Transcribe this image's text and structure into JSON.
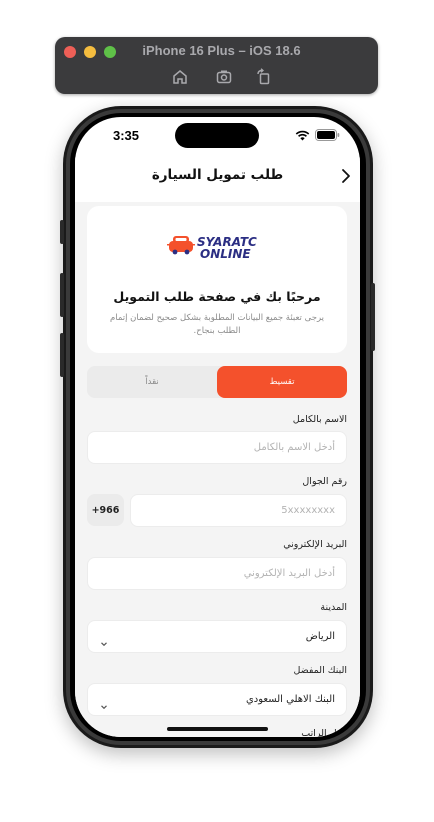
{
  "simulator": {
    "title": "iPhone 16 Plus – iOS 18.6",
    "tools": [
      "home-icon",
      "screenshot-icon",
      "rotate-icon"
    ]
  },
  "status_bar": {
    "time": "3:35"
  },
  "nav": {
    "title": "طلب تمويل السيارة",
    "back_icon": "chevron-right-icon"
  },
  "welcome": {
    "logo_text_1": "SYARATC",
    "logo_text_2": "ONLINE",
    "title": "مرحبًا بك في صفحة طلب التمويل",
    "subtitle": "يرجى تعبئة جميع البيانات المطلوبة بشكل صحيح لضمان إتمام الطلب بنجاح."
  },
  "payment_toggle": {
    "active": "تقسيط",
    "inactive": "نقداً"
  },
  "form": {
    "full_name": {
      "label": "الاسم بالكامل",
      "placeholder": "أدخل الاسم بالكامل"
    },
    "phone": {
      "label": "رقم الجوال",
      "prefix": "+966",
      "placeholder": "5xxxxxxxx"
    },
    "email": {
      "label": "البريد الإلكتروني",
      "placeholder": "أدخل البريد الإلكتروني"
    },
    "city": {
      "label": "المدينة",
      "value": "الرياض"
    },
    "bank": {
      "label": "البنك المفضل",
      "value": "البنك الاهلي السعودي"
    },
    "salary": {
      "label": "دخل الراتب"
    }
  },
  "colors": {
    "accent": "#f4512c",
    "logo_navy": "#2b2e83",
    "background": "#f4f4f4"
  }
}
